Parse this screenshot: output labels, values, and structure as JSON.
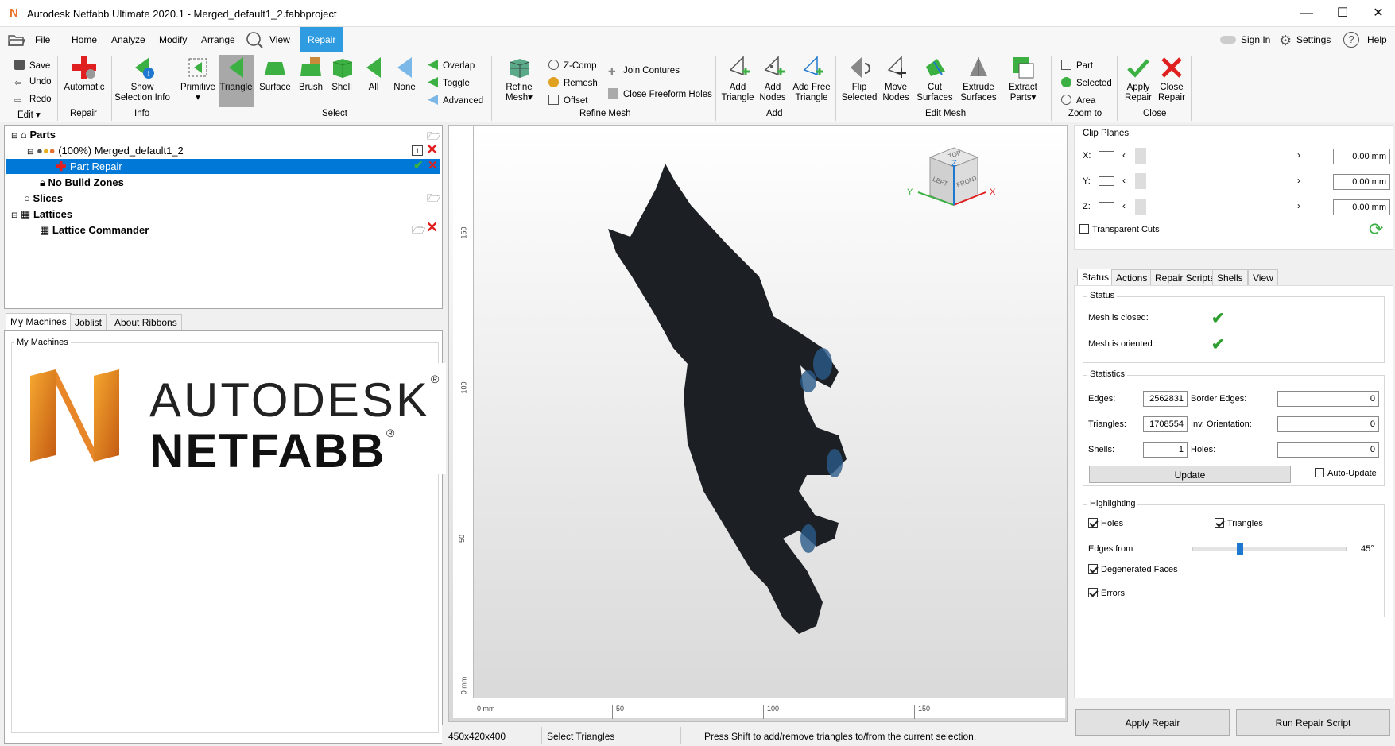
{
  "window": {
    "title": "Autodesk Netfabb Ultimate 2020.1 - Merged_default1_2.fabbproject",
    "app_icon": "N"
  },
  "menu": {
    "file": "File",
    "home": "Home",
    "analyze": "Analyze",
    "modify": "Modify",
    "arrange": "Arrange",
    "view": "View",
    "repair": "Repair",
    "sign_in": "Sign In",
    "settings": "Settings",
    "help": "Help"
  },
  "ribbon": {
    "save": "Save",
    "undo": "Undo",
    "redo": "Redo",
    "edit": "Edit",
    "automatic": "Automatic",
    "repair_group": "Repair",
    "show": "Show",
    "selection_info": "Selection Info",
    "info_group": "Info",
    "primitive": "Primitive",
    "triangle": "Triangle",
    "surface": "Surface",
    "brush": "Brush",
    "shell": "Shell",
    "all": "All",
    "none": "None",
    "overlap": "Overlap",
    "toggle": "Toggle",
    "advanced": "Advanced",
    "select_group": "Select",
    "refine": "Refine",
    "mesh": "Mesh",
    "zcomp": "Z-Comp",
    "remesh": "Remesh",
    "offset": "Offset",
    "join_contures": "Join Contures",
    "close_freeform": "Close Freeform Holes",
    "refine_group": "Refine Mesh",
    "add_triangle_1": "Add",
    "add_triangle_2": "Triangle",
    "add_nodes_1": "Add",
    "add_nodes_2": "Nodes",
    "add_free_1": "Add Free",
    "add_free_2": "Triangle",
    "add_group": "Add",
    "flip_1": "Flip",
    "flip_2": "Selected",
    "move_1": "Move",
    "move_2": "Nodes",
    "cut_1": "Cut",
    "cut_2": "Surfaces",
    "extrude_1": "Extrude",
    "extrude_2": "Surfaces",
    "extract_1": "Extract",
    "extract_2": "Parts",
    "editmesh_group": "Edit Mesh",
    "part": "Part",
    "selected": "Selected",
    "area": "Area",
    "zoom_group": "Zoom to",
    "apply_1": "Apply",
    "apply_2": "Repair",
    "close_1": "Close",
    "close_2": "Repair",
    "close_group": "Close"
  },
  "tree": {
    "parts": "Parts",
    "merged": "(100%) Merged_default1_2",
    "part_repair": "Part Repair",
    "no_build_zones": "No Build Zones",
    "slices": "Slices",
    "lattices": "Lattices",
    "lattice_commander": "Lattice Commander",
    "badge": "1"
  },
  "machines": {
    "tabs": [
      "My Machines",
      "Joblist",
      "About Ribbons"
    ],
    "group_title": "My Machines",
    "logo_line1": "AUTODESK",
    "logo_line2": "NETFABB",
    "reg": "®"
  },
  "viewport": {
    "cube": {
      "top": "TOP",
      "left": "LEFT",
      "front": "FRONT",
      "axis_x": "X",
      "axis_y": "Y",
      "axis_z": "Z"
    },
    "hticks": [
      "0 mm",
      "50",
      "100",
      "150"
    ],
    "vticks": [
      "150",
      "100",
      "50",
      "0 mm"
    ]
  },
  "clip": {
    "title": "Clip Planes",
    "x_label": "X:",
    "y_label": "Y:",
    "z_label": "Z:",
    "x_val": "0.00 mm",
    "y_val": "0.00 mm",
    "z_val": "0.00 mm",
    "transparent": "Transparent Cuts"
  },
  "repair_panel": {
    "tabs": [
      "Status",
      "Actions",
      "Repair Scripts",
      "Shells",
      "View"
    ],
    "status_title": "Status",
    "mesh_closed": "Mesh is closed:",
    "mesh_oriented": "Mesh is oriented:",
    "stats_title": "Statistics",
    "edges_label": "Edges:",
    "edges": "2562831",
    "border_label": "Border Edges:",
    "border": "0",
    "tri_label": "Triangles:",
    "triangles": "1708554",
    "inv_label": "Inv. Orientation:",
    "inv": "0",
    "shells_label": "Shells:",
    "shells": "1",
    "holes_label": "Holes:",
    "holes": "0",
    "update": "Update",
    "auto_update": "Auto-Update",
    "hl_title": "Highlighting",
    "holes_chk": "Holes",
    "triangles_chk": "Triangles",
    "edges_from": "Edges from",
    "angle": "45°",
    "angle_fraction": 0.3,
    "degenerated": "Degenerated Faces",
    "errors": "Errors",
    "apply_repair": "Apply Repair",
    "run_script": "Run Repair Script"
  },
  "status": {
    "size": "450x420x400",
    "mode": "Select Triangles",
    "hint": "Press Shift to add/remove triangles to/from the current selection."
  },
  "colors": {
    "accent": "#2f9be0",
    "selection": "#0078d7",
    "green": "#3cb043",
    "red": "#e02020",
    "mesh": "#1c1f24"
  }
}
